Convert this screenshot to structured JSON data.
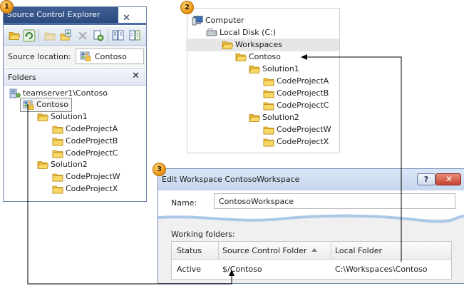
{
  "badges": [
    "1",
    "2",
    "3"
  ],
  "explorer": {
    "tab_title": "Source Control Explorer",
    "tab_close_glyph": "✕",
    "toolbar_icons": [
      "open-folder-icon",
      "refresh-icon",
      "folder-icon",
      "new-folder-icon",
      "delete-icon",
      "add-files-icon",
      "workspace-icon",
      "compare-icon"
    ],
    "source_location_label": "Source location:",
    "source_location_value": "Contoso",
    "folders_header": "Folders",
    "folders_close_glyph": "✕",
    "tree": {
      "server": "teamserver1\\Contoso",
      "project": "Contoso",
      "solution1": "Solution1",
      "solution1_items": [
        "CodeProjectA",
        "CodeProjectB",
        "CodeProjectC"
      ],
      "solution2": "Solution2",
      "solution2_items": [
        "CodeProjectW",
        "CodeProjectX"
      ]
    }
  },
  "local": {
    "computer": "Computer",
    "disk": "Local Disk (C:)",
    "workspaces": "Workspaces",
    "contoso": "Contoso",
    "solution1": "Solution1",
    "solution1_items": [
      "CodeProjectA",
      "CodeProjectB",
      "CodeProjectC"
    ],
    "solution2": "Solution2",
    "solution2_items": [
      "CodeProjectW",
      "CodeProjectX"
    ]
  },
  "dialog": {
    "title": "Edit Workspace ContosoWorkspace",
    "help_glyph": "?",
    "close_glyph": "✕",
    "name_label": "Name:",
    "name_value": "ContosoWorkspace",
    "working_folders_label": "Working folders:",
    "columns": [
      "Status",
      "Source Control Folder",
      "Local Folder"
    ],
    "row": {
      "status": "Active",
      "source_folder": "$/Contoso",
      "local_folder": "C:\\Workspaces\\Contoso"
    }
  },
  "colors": {
    "tab_blue": "#2b4a7e",
    "folder_yellow": "#f2c444",
    "badge_orange": "#f0a020"
  }
}
